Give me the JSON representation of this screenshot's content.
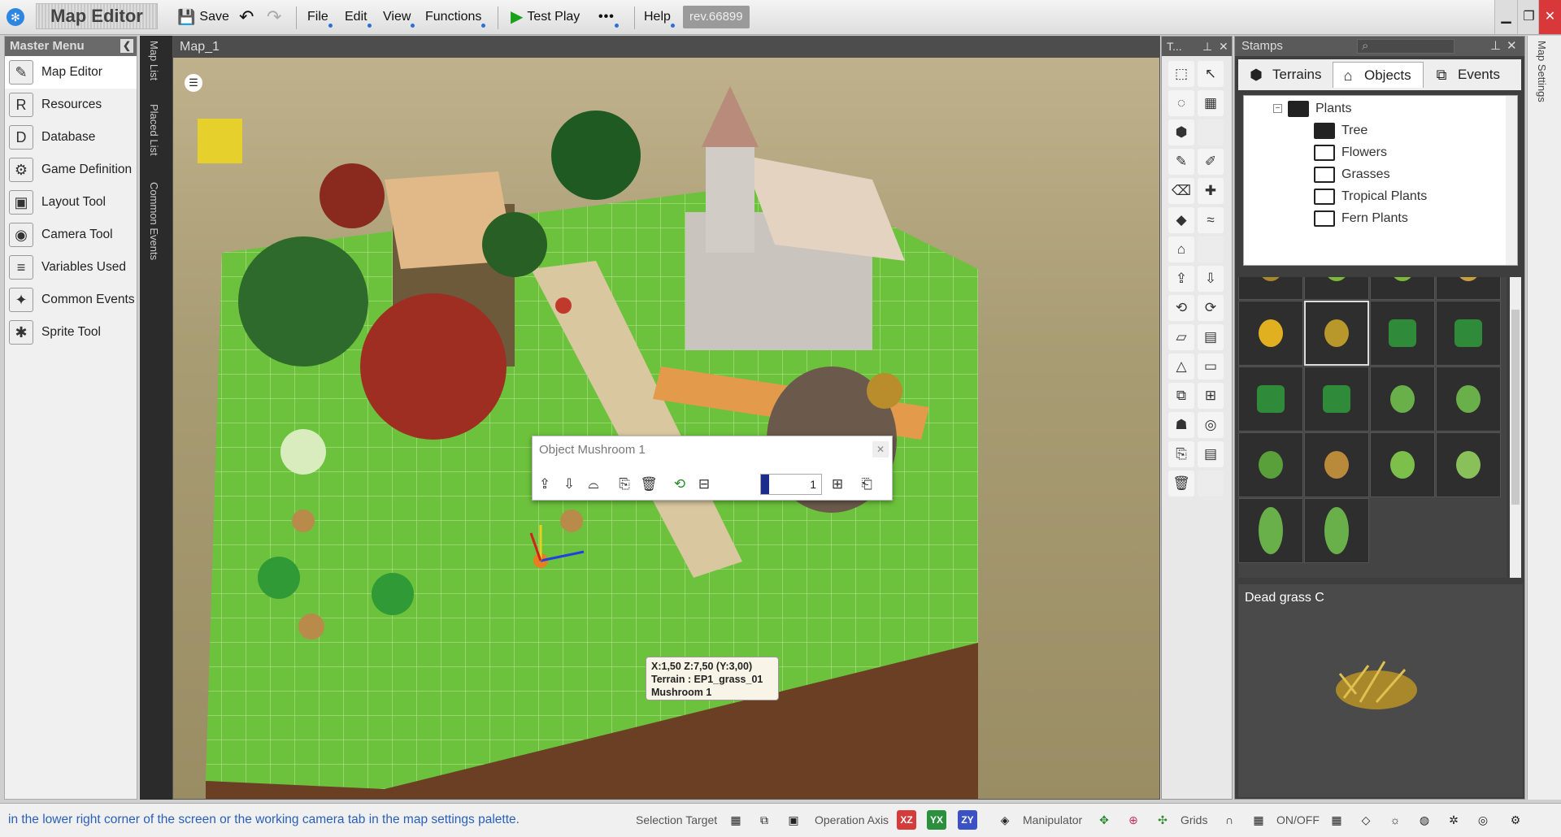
{
  "app": {
    "title": "Map Editor",
    "logo_icon": "app-logo-icon"
  },
  "toolbar": {
    "save": "Save",
    "menus": [
      "File",
      "Edit",
      "View",
      "Functions"
    ],
    "test_play": "Test Play",
    "more": "•••",
    "help": "Help",
    "revision": "rev.66899"
  },
  "master_menu": {
    "title": "Master Menu",
    "items": [
      {
        "label": "Map Editor",
        "icon": "map-editor-icon",
        "glyph": "✎"
      },
      {
        "label": "Resources",
        "icon": "resources-icon",
        "glyph": "R"
      },
      {
        "label": "Database",
        "icon": "database-icon",
        "glyph": "D"
      },
      {
        "label": "Game Definition",
        "icon": "gamepad-icon",
        "glyph": "⚙"
      },
      {
        "label": "Layout Tool",
        "icon": "layout-icon",
        "glyph": "▣"
      },
      {
        "label": "Camera Tool",
        "icon": "camera-icon",
        "glyph": "◉"
      },
      {
        "label": "Variables Used",
        "icon": "variables-icon",
        "glyph": "≡"
      },
      {
        "label": "Common Events",
        "icon": "events-icon",
        "glyph": "✦"
      },
      {
        "label": "Sprite Tool",
        "icon": "sprite-icon",
        "glyph": "✱"
      }
    ]
  },
  "side_tabs": [
    "Map List",
    "Placed List",
    "Common Events"
  ],
  "map": {
    "tab": "Map_1"
  },
  "tool_palette": {
    "title": "T..."
  },
  "stamps": {
    "title": "Stamps",
    "tabs": [
      "Terrains",
      "Objects",
      "Events"
    ],
    "tree": [
      {
        "label": "Plants",
        "level": 0,
        "open": true
      },
      {
        "label": "Tree",
        "level": 1,
        "open": true
      },
      {
        "label": "Flowers",
        "level": 1,
        "open": false
      },
      {
        "label": "Grasses",
        "level": 1,
        "open": false
      },
      {
        "label": "Tropical Plants",
        "level": 1,
        "open": false
      },
      {
        "label": "Fern Plants",
        "level": 1,
        "open": false
      }
    ],
    "preview_name": "Dead grass C"
  },
  "map_settings": "Map Settings",
  "object_popup": {
    "title": "Object Mushroom 1",
    "count": "1"
  },
  "tooltip": {
    "line1": "X:1,50 Z:7,50 (Y:3,00)",
    "line2": "Terrain : EP1_grass_01",
    "line3": "Mushroom 1"
  },
  "status": {
    "message": "in the lower right corner of the screen or the working camera tab in the map settings palette.",
    "selection_target": "Selection Target",
    "operation_axis": "Operation Axis",
    "axes": [
      "XZ",
      "YX",
      "ZY"
    ],
    "manipulator": "Manipulator",
    "grids": "Grids",
    "onoff": "ON/OFF"
  },
  "colors": {
    "accent": "#2f86e0",
    "play": "#1aa11a",
    "axis_xz": "#d43b3b",
    "axis_yx": "#2c8f3e",
    "axis_zy": "#3a52c4"
  }
}
